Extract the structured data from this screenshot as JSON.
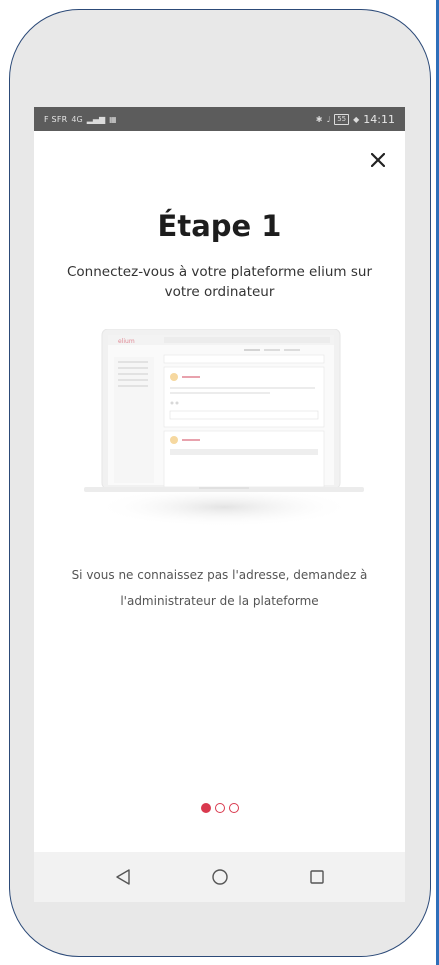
{
  "status_bar": {
    "carrier": "F SFR",
    "network": "4G",
    "time": "14:11",
    "battery": "55"
  },
  "onboarding": {
    "title": "Étape 1",
    "subtitle": "Connectez-vous à votre plateforme elium sur votre ordinateur",
    "info": "Si vous ne connaissez pas l'adresse, demandez à l'administrateur de la plateforme",
    "close_label": "✕",
    "step_index": 1,
    "step_count": 3
  },
  "illustration": {
    "logo_text": "elium"
  },
  "colors": {
    "accent": "#d9394e",
    "status_bar": "#5c5c5c",
    "frame_border": "#2c4a78",
    "nav_bar": "#f2f2f2"
  },
  "icons": {
    "close": "close-icon",
    "back": "triangle-back-icon",
    "home": "circle-home-icon",
    "recents": "square-recents-icon"
  }
}
